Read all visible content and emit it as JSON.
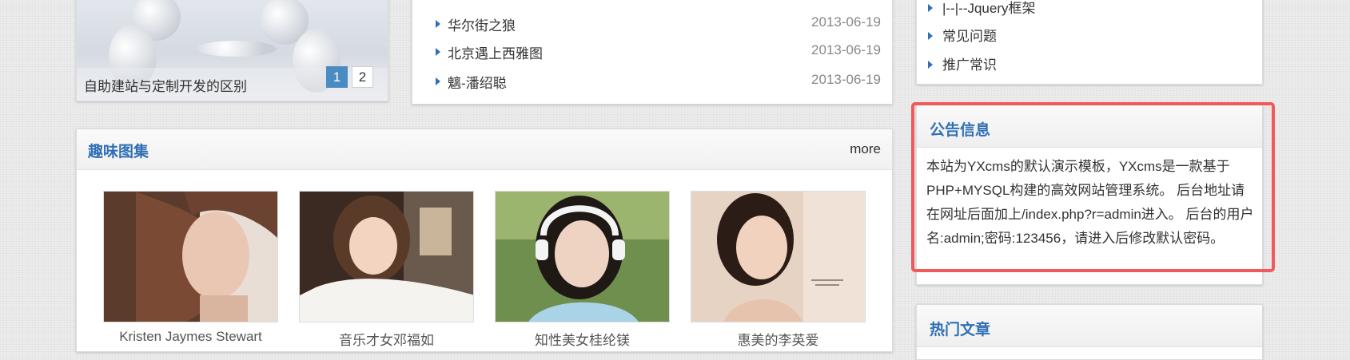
{
  "slideshow": {
    "caption": "自助建站与定制开发的区别",
    "pages": [
      "1",
      "2"
    ]
  },
  "news": [
    {
      "title": "华尔街之狼",
      "date": "2013-06-19"
    },
    {
      "title": "北京遇上西雅图",
      "date": "2013-06-19"
    },
    {
      "title": "魑-潘绍聪",
      "date": "2013-06-19"
    }
  ],
  "gallery": {
    "title": "趣味图集",
    "more": "more",
    "items": [
      {
        "caption": "Kristen Jaymes Stewart"
      },
      {
        "caption": "音乐才女邓福如"
      },
      {
        "caption": "知性美女桂纶镁"
      },
      {
        "caption": "惠美的李英爱"
      }
    ]
  },
  "categories": [
    "|--|--Jquery框架",
    "常见问题",
    "推广常识"
  ],
  "notice": {
    "title": "公告信息",
    "body": "本站为YXcms的默认演示模板，YXcms是一款基于PHP+MYSQL构建的高效网站管理系统。 后台地址请在网址后面加上/index.php?r=admin进入。 后台的用户名:admin;密码:123456，请进入后修改默认密码。"
  },
  "hot": {
    "title": "热门文章"
  },
  "colors": {
    "accent": "#2f6fb5",
    "pager_active": "#4a8cc2",
    "highlight": "#f05a5a"
  }
}
